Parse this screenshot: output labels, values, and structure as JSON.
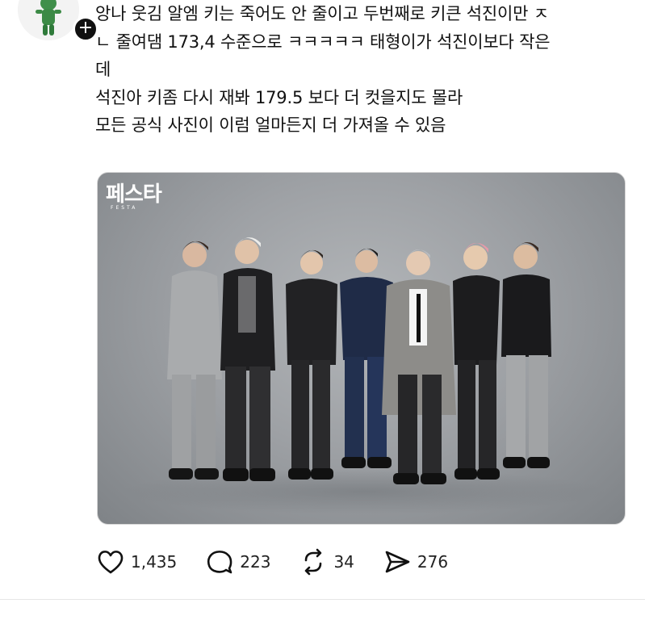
{
  "post": {
    "text_lines": [
      "앙나 웃김 알엠 키는 죽어도 안 줄이고 두번째로 키큰 석진이만 ㅈ",
      "ㄴ 줄여댐 173,4 수준으로 ㅋㅋㅋㅋㅋ 태형이가 석진이보다 작은",
      "데",
      "석진아 키좀 다시 재봐 179.5 보다 더 컷을지도 몰라",
      "모든 공식 사진이 이럼 얼마든지 더 가져올 수 있음"
    ],
    "follow_symbol": "+",
    "image": {
      "logo": "페스타",
      "logo_sub": "FESTA"
    }
  },
  "actions": {
    "likes": "1,435",
    "replies": "223",
    "reposts": "34",
    "shares": "276"
  },
  "colors": {
    "text": "#111111",
    "backdrop": "#9ea1a5",
    "follow_badge": "#111111"
  }
}
